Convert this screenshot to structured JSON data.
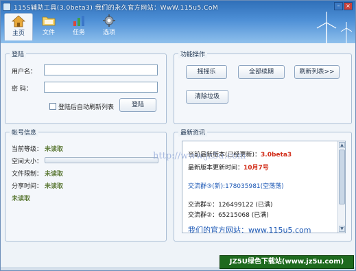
{
  "window": {
    "title": "115S辅助工具(3.0beta3) 我们的永久官方网站：WwW.115u5.CoM"
  },
  "toolbar": [
    {
      "label": "主页",
      "icon": "home-icon"
    },
    {
      "label": "文件",
      "icon": "folder-icon"
    },
    {
      "label": "任务",
      "icon": "tasks-icon"
    },
    {
      "label": "选项",
      "icon": "settings-icon"
    }
  ],
  "login": {
    "title": "登陆",
    "username_label": "用户名：",
    "password_label": "密  码：",
    "username_value": "",
    "password_value": "",
    "auto_refresh_label": "登陆后自动刷新列表",
    "login_button": "登陆"
  },
  "functions": {
    "title": "功能操作",
    "shake_button": "摇摇乐",
    "renew_all_button": "全部续期",
    "refresh_list_button": "刷新列表>>",
    "clear_junk_button": "清除垃圾"
  },
  "account": {
    "title": "帐号信息",
    "rows": [
      {
        "label": "当前等级：",
        "value": "未读取"
      },
      {
        "label": "空间大小：",
        "value": ""
      },
      {
        "label": "文件限制：",
        "value": "未读取"
      },
      {
        "label": "分享时间：",
        "value": "未读取"
      }
    ],
    "status": "未读取",
    "space_fraction": 0
  },
  "news": {
    "title": "最新资讯",
    "lines": [
      {
        "prefix": "当前最新版本(已经更新)：",
        "highlight": "3.0beta3",
        "style": "red"
      },
      {
        "prefix": "最新版本更新时间：",
        "highlight": "10月7号",
        "style": "red"
      },
      {
        "prefix": "交流群③(新):178035981(空荡荡)",
        "highlight": "",
        "style": "blue"
      },
      {
        "prefix": "交流群①：126499122 (已满)",
        "highlight": "",
        "style": "plain"
      },
      {
        "prefix": "交流群②：65215068 (已满)",
        "highlight": "",
        "style": "plain"
      },
      {
        "prefix": "我们的官方网站：www.115u5.com",
        "highlight": "",
        "style": "blue"
      }
    ]
  },
  "watermark": {
    "url": "http://www.jz5u.com",
    "badge": "JZ5U绿色下载站(www.jz5u.com)"
  },
  "colors": {
    "accent": "#2f6fb8",
    "value_green": "#5f7c3a",
    "news_red": "#d12b17"
  }
}
